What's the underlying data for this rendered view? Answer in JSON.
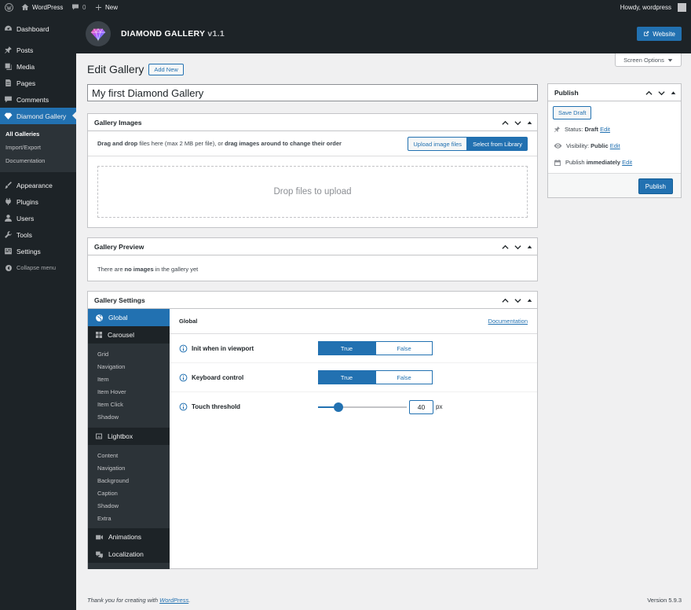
{
  "adminbar": {
    "site_name": "WordPress",
    "comments_count": "0",
    "new_label": "New",
    "howdy": "Howdy, wordpress"
  },
  "sidebar": {
    "items": [
      {
        "label": "Dashboard",
        "icon": "dashboard-icon"
      },
      {
        "label": "Posts",
        "icon": "pin-icon"
      },
      {
        "label": "Media",
        "icon": "media-icon"
      },
      {
        "label": "Pages",
        "icon": "pages-icon"
      },
      {
        "label": "Comments",
        "icon": "comment-icon"
      },
      {
        "label": "Diamond Gallery",
        "icon": "diamond-icon"
      }
    ],
    "submenu": [
      "All Galleries",
      "Import/Export",
      "Documentation"
    ],
    "items2": [
      {
        "label": "Appearance",
        "icon": "brush-icon"
      },
      {
        "label": "Plugins",
        "icon": "plug-icon"
      },
      {
        "label": "Users",
        "icon": "user-icon"
      },
      {
        "label": "Tools",
        "icon": "wrench-icon"
      },
      {
        "label": "Settings",
        "icon": "settings-icon"
      }
    ],
    "collapse": "Collapse menu"
  },
  "topbar": {
    "brand": "DIAMOND GALLERY",
    "version": "v1.1",
    "website_label": "Website"
  },
  "screen_options": "Screen Options",
  "page": {
    "title": "Edit Gallery",
    "add_new": "Add New",
    "gallery_title": "My first Diamond Gallery"
  },
  "gallery_images": {
    "title": "Gallery Images",
    "hint_bold1": "Drag and drop",
    "hint_text1": " files here (max 2 MB per file), or ",
    "hint_bold2": "drag images around to change their order",
    "upload_label": "Upload image files",
    "library_label": "Select from Library",
    "drop_text": "Drop files to upload"
  },
  "gallery_preview": {
    "title": "Gallery Preview",
    "text1": "There are ",
    "bold": "no images",
    "text2": " in the gallery yet"
  },
  "gallery_settings": {
    "title": "Gallery Settings",
    "tabs": {
      "global": "Global",
      "carousel": "Carousel",
      "carousel_sub": [
        "Grid",
        "Navigation",
        "Item",
        "Item Hover",
        "Item Click",
        "Shadow"
      ],
      "lightbox": "Lightbox",
      "lightbox_sub": [
        "Content",
        "Navigation",
        "Background",
        "Caption",
        "Shadow",
        "Extra"
      ],
      "animations": "Animations",
      "localization": "Localization"
    },
    "section_title": "Global",
    "doc_link": "Documentation",
    "rows": [
      {
        "label": "Init when in viewport",
        "true_label": "True",
        "false_label": "False",
        "value": "True"
      },
      {
        "label": "Keyboard control",
        "true_label": "True",
        "false_label": "False",
        "value": "True"
      }
    ],
    "touch": {
      "label": "Touch threshold",
      "value": "40",
      "unit": "px",
      "slider_fraction": 0.23
    }
  },
  "publish": {
    "title": "Publish",
    "save_draft": "Save Draft",
    "status_label": "Status:",
    "status_value": "Draft",
    "visibility_label": "Visibility:",
    "visibility_value": "Public",
    "publish_label": "Publish",
    "publish_value": "immediately",
    "edit": "Edit",
    "publish_button": "Publish"
  },
  "footer": {
    "thanks": "Thank you for creating with ",
    "wp_link": "WordPress",
    "dot": ".",
    "version": "Version 5.9.3"
  },
  "colors": {
    "accent": "#2271b1",
    "admin_dark": "#1d2327",
    "submenu": "#2c3338"
  }
}
